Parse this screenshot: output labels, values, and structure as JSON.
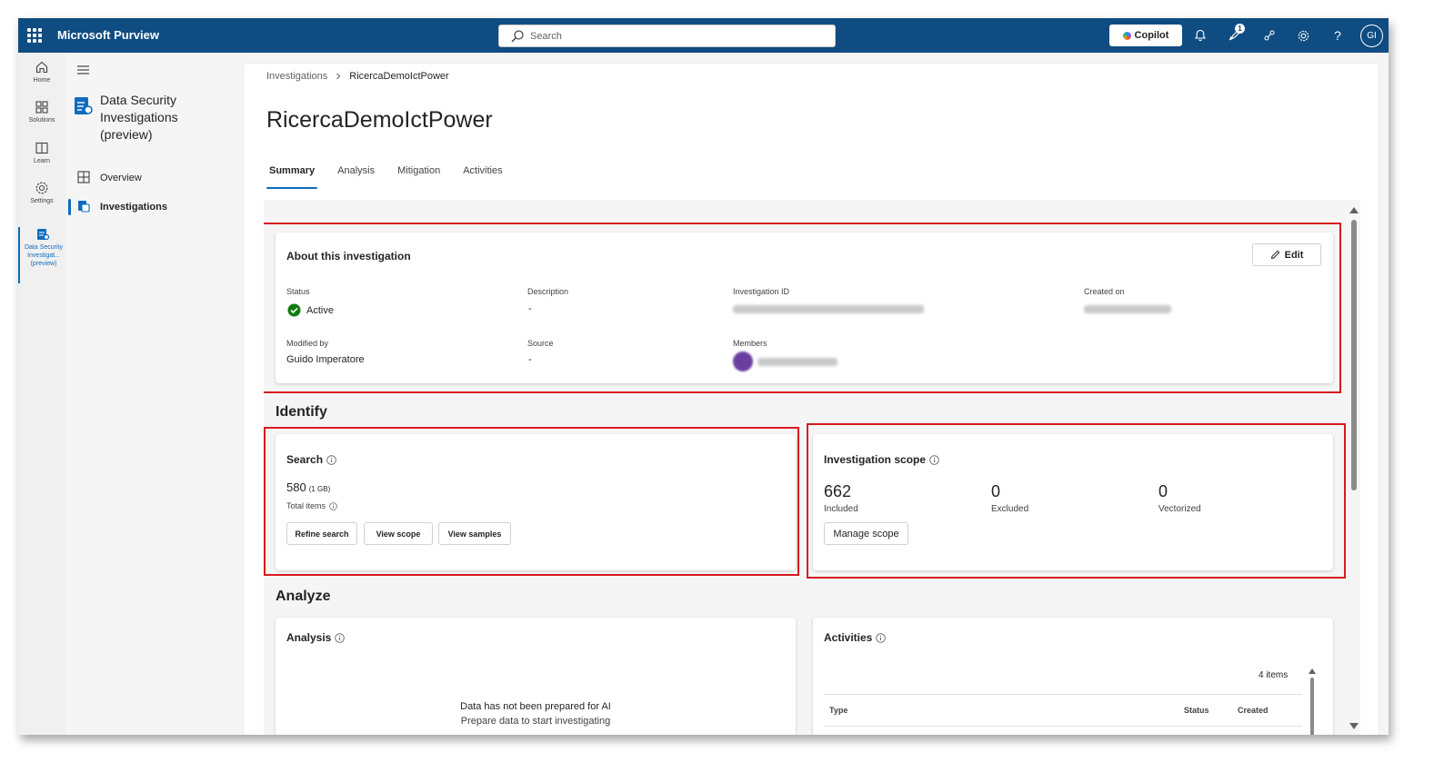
{
  "app": {
    "title": "Microsoft Purview"
  },
  "topbar": {
    "search_placeholder": "Search",
    "copilot_label": "Copilot",
    "notification_badge": "1",
    "avatar_initials": "GI",
    "icons": [
      "waffle-icon",
      "search-icon",
      "bell-icon",
      "rocket-icon",
      "share-icon",
      "gear-icon",
      "help-icon"
    ]
  },
  "rail": {
    "items": [
      {
        "label": "Home",
        "icon": "home-icon"
      },
      {
        "label": "Solutions",
        "icon": "solutions-icon"
      },
      {
        "label": "Learn",
        "icon": "book-icon"
      },
      {
        "label": "Settings",
        "icon": "gear-icon"
      },
      {
        "label": "Data Security Investigat... (preview)",
        "icon": "investigation-icon",
        "active": true
      }
    ]
  },
  "sidenav": {
    "header": "Data Security Investigations (preview)",
    "items": [
      {
        "label": "Overview",
        "icon": "overview-icon"
      },
      {
        "label": "Investigations",
        "icon": "investigations-icon",
        "active": true
      }
    ]
  },
  "breadcrumb": {
    "parent": "Investigations",
    "current": "RicercaDemoIctPower"
  },
  "page": {
    "title": "RicercaDemoIctPower"
  },
  "tabs": [
    "Summary",
    "Analysis",
    "Mitigation",
    "Activities"
  ],
  "about": {
    "title": "About this investigation",
    "edit_label": "Edit",
    "status_label": "Status",
    "status_value": "Active",
    "description_label": "Description",
    "description_value": "-",
    "investigation_id_label": "Investigation ID",
    "created_on_label": "Created on",
    "modified_by_label": "Modified by",
    "modified_by_value": "Guido Imperatore",
    "source_label": "Source",
    "source_value": "-",
    "members_label": "Members",
    "status_color": "#107c10"
  },
  "identify": {
    "title": "Identify",
    "search_card": {
      "title": "Search",
      "total_count": "580",
      "total_size": "(1 GB)",
      "total_label": "Total items",
      "buttons": [
        "Refine search",
        "View scope",
        "View samples"
      ]
    },
    "scope_card": {
      "title": "Investigation scope",
      "stats": [
        {
          "value": "662",
          "label": "Included"
        },
        {
          "value": "0",
          "label": "Excluded"
        },
        {
          "value": "0",
          "label": "Vectorized"
        }
      ],
      "manage_label": "Manage scope"
    }
  },
  "analyze": {
    "title": "Analyze",
    "analysis_card": {
      "title": "Analysis",
      "empty_title": "Data has not been prepared for AI",
      "empty_subtitle": "Prepare data to start investigating"
    },
    "activities_card": {
      "title": "Activities",
      "count": "4 items",
      "columns": [
        "Type",
        "Status",
        "Created"
      ]
    }
  },
  "colors": {
    "topbar": "#0f4c81",
    "accent": "#0f6cbd",
    "highlight": "#d71a1f",
    "success": "#107c10"
  }
}
